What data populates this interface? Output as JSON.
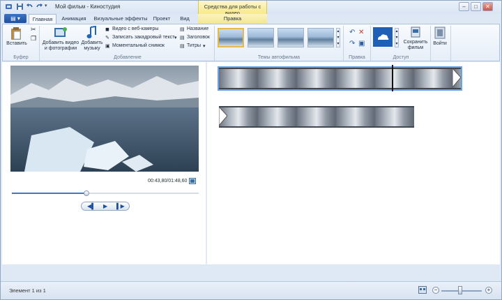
{
  "title": {
    "app": "Мой фильм - Киностудия",
    "contextual": "Средства для работы с видео"
  },
  "tabs": [
    "Главная",
    "Анимация",
    "Визуальные эффекты",
    "Проект",
    "Вид",
    "Правка"
  ],
  "ribbon": {
    "clipboard": {
      "paste": "Вставить",
      "group": "Буфер"
    },
    "add": {
      "add_video_photos": "Добавить видео и фотографии",
      "add_music": "Добавить музыку",
      "webcam": "Видео с веб-камеры",
      "narration": "Записать закадровый текст",
      "snapshot": "Моментальный снимок",
      "title": "Название",
      "caption": "Заголовок",
      "credits": "Титры",
      "group": "Добавление"
    },
    "themes_group": "Темы автофильма",
    "edit_group": "Правка",
    "access": {
      "save_movie": "Сохранить фильм",
      "group": "Доступ"
    },
    "sign_in": "Войти"
  },
  "preview": {
    "time": "00:43,80/01:48,60",
    "progress": 0.4
  },
  "status": {
    "text": "Элемент 1 из 1"
  },
  "zoom": {
    "level": 0.45
  },
  "colors": {
    "accent": "#1d4f9e",
    "context": "#f7e98a"
  }
}
